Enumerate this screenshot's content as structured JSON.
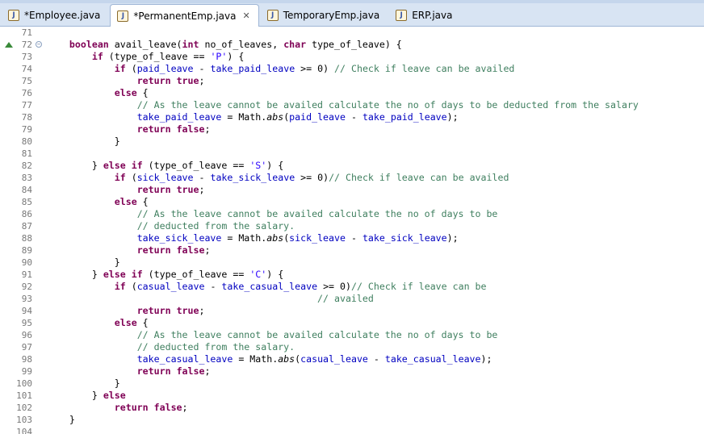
{
  "tabs": [
    {
      "label": "*Employee.java",
      "active": false,
      "closable": false
    },
    {
      "label": "*PermanentEmp.java",
      "active": true,
      "closable": true
    },
    {
      "label": "TemporaryEmp.java",
      "active": false,
      "closable": false
    },
    {
      "label": "ERP.java",
      "active": false,
      "closable": false
    }
  ],
  "colors": {
    "keyword": "#7f0055",
    "field": "#0000c0",
    "string": "#2a00ff",
    "comment": "#3f7f5f",
    "line_number": "#787878"
  },
  "lines": [
    {
      "num": "71",
      "tokens": []
    },
    {
      "num": "72",
      "mark": true,
      "fold": true,
      "tokens": [
        {
          "t": "    "
        },
        {
          "t": "boolean",
          "c": "kw"
        },
        {
          "t": " avail_leave("
        },
        {
          "t": "int",
          "c": "kw"
        },
        {
          "t": " no_of_leaves, "
        },
        {
          "t": "char",
          "c": "kw"
        },
        {
          "t": " type_of_leave) {"
        }
      ]
    },
    {
      "num": "73",
      "tokens": [
        {
          "t": "        "
        },
        {
          "t": "if",
          "c": "kw"
        },
        {
          "t": " (type_of_leave == "
        },
        {
          "t": "'P'",
          "c": "str"
        },
        {
          "t": ") {"
        }
      ]
    },
    {
      "num": "74",
      "tokens": [
        {
          "t": "            "
        },
        {
          "t": "if",
          "c": "kw"
        },
        {
          "t": " ("
        },
        {
          "t": "paid_leave",
          "c": "fld"
        },
        {
          "t": " - "
        },
        {
          "t": "take_paid_leave",
          "c": "fld"
        },
        {
          "t": " >= 0) "
        },
        {
          "t": "// Check if leave can be availed",
          "c": "cmt"
        }
      ]
    },
    {
      "num": "75",
      "tokens": [
        {
          "t": "                "
        },
        {
          "t": "return",
          "c": "kw"
        },
        {
          "t": " "
        },
        {
          "t": "true",
          "c": "kw"
        },
        {
          "t": ";"
        }
      ]
    },
    {
      "num": "76",
      "tokens": [
        {
          "t": "            "
        },
        {
          "t": "else",
          "c": "kw"
        },
        {
          "t": " {"
        }
      ]
    },
    {
      "num": "77",
      "tokens": [
        {
          "t": "                "
        },
        {
          "t": "// As the leave cannot be availed calculate the no of days to be deducted from the salary",
          "c": "cmt"
        }
      ]
    },
    {
      "num": "78",
      "tokens": [
        {
          "t": "                "
        },
        {
          "t": "take_paid_leave",
          "c": "fld"
        },
        {
          "t": " = Math."
        },
        {
          "t": "abs",
          "c": "it"
        },
        {
          "t": "("
        },
        {
          "t": "paid_leave",
          "c": "fld"
        },
        {
          "t": " - "
        },
        {
          "t": "take_paid_leave",
          "c": "fld"
        },
        {
          "t": ");"
        }
      ]
    },
    {
      "num": "79",
      "tokens": [
        {
          "t": "                "
        },
        {
          "t": "return",
          "c": "kw"
        },
        {
          "t": " "
        },
        {
          "t": "false",
          "c": "kw"
        },
        {
          "t": ";"
        }
      ]
    },
    {
      "num": "80",
      "tokens": [
        {
          "t": "            }"
        }
      ]
    },
    {
      "num": "81",
      "tokens": []
    },
    {
      "num": "82",
      "tokens": [
        {
          "t": "        } "
        },
        {
          "t": "else",
          "c": "kw"
        },
        {
          "t": " "
        },
        {
          "t": "if",
          "c": "kw"
        },
        {
          "t": " (type_of_leave == "
        },
        {
          "t": "'S'",
          "c": "str"
        },
        {
          "t": ") {"
        }
      ]
    },
    {
      "num": "83",
      "tokens": [
        {
          "t": "            "
        },
        {
          "t": "if",
          "c": "kw"
        },
        {
          "t": " ("
        },
        {
          "t": "sick_leave",
          "c": "fld"
        },
        {
          "t": " - "
        },
        {
          "t": "take_sick_leave",
          "c": "fld"
        },
        {
          "t": " >= 0)"
        },
        {
          "t": "// Check if leave can be availed",
          "c": "cmt"
        }
      ]
    },
    {
      "num": "84",
      "tokens": [
        {
          "t": "                "
        },
        {
          "t": "return",
          "c": "kw"
        },
        {
          "t": " "
        },
        {
          "t": "true",
          "c": "kw"
        },
        {
          "t": ";"
        }
      ]
    },
    {
      "num": "85",
      "tokens": [
        {
          "t": "            "
        },
        {
          "t": "else",
          "c": "kw"
        },
        {
          "t": " {"
        }
      ]
    },
    {
      "num": "86",
      "tokens": [
        {
          "t": "                "
        },
        {
          "t": "// As the leave cannot be availed calculate the no of days to be",
          "c": "cmt"
        }
      ]
    },
    {
      "num": "87",
      "tokens": [
        {
          "t": "                "
        },
        {
          "t": "// deducted from the salary.",
          "c": "cmt"
        }
      ]
    },
    {
      "num": "88",
      "tokens": [
        {
          "t": "                "
        },
        {
          "t": "take_sick_leave",
          "c": "fld"
        },
        {
          "t": " = Math."
        },
        {
          "t": "abs",
          "c": "it"
        },
        {
          "t": "("
        },
        {
          "t": "sick_leave",
          "c": "fld"
        },
        {
          "t": " - "
        },
        {
          "t": "take_sick_leave",
          "c": "fld"
        },
        {
          "t": ");"
        }
      ]
    },
    {
      "num": "89",
      "tokens": [
        {
          "t": "                "
        },
        {
          "t": "return",
          "c": "kw"
        },
        {
          "t": " "
        },
        {
          "t": "false",
          "c": "kw"
        },
        {
          "t": ";"
        }
      ]
    },
    {
      "num": "90",
      "tokens": [
        {
          "t": "            }"
        }
      ]
    },
    {
      "num": "91",
      "tokens": [
        {
          "t": "        } "
        },
        {
          "t": "else",
          "c": "kw"
        },
        {
          "t": " "
        },
        {
          "t": "if",
          "c": "kw"
        },
        {
          "t": " (type_of_leave == "
        },
        {
          "t": "'C'",
          "c": "str"
        },
        {
          "t": ") {"
        }
      ]
    },
    {
      "num": "92",
      "tokens": [
        {
          "t": "            "
        },
        {
          "t": "if",
          "c": "kw"
        },
        {
          "t": " ("
        },
        {
          "t": "casual_leave",
          "c": "fld"
        },
        {
          "t": " - "
        },
        {
          "t": "take_casual_leave",
          "c": "fld"
        },
        {
          "t": " >= 0)"
        },
        {
          "t": "// Check if leave can be",
          "c": "cmt"
        }
      ]
    },
    {
      "num": "93",
      "tokens": [
        {
          "t": "                                                "
        },
        {
          "t": "// availed",
          "c": "cmt"
        }
      ]
    },
    {
      "num": "94",
      "tokens": [
        {
          "t": "                "
        },
        {
          "t": "return",
          "c": "kw"
        },
        {
          "t": " "
        },
        {
          "t": "true",
          "c": "kw"
        },
        {
          "t": ";"
        }
      ]
    },
    {
      "num": "95",
      "tokens": [
        {
          "t": "            "
        },
        {
          "t": "else",
          "c": "kw"
        },
        {
          "t": " {"
        }
      ]
    },
    {
      "num": "96",
      "tokens": [
        {
          "t": "                "
        },
        {
          "t": "// As the leave cannot be availed calculate the no of days to be",
          "c": "cmt"
        }
      ]
    },
    {
      "num": "97",
      "tokens": [
        {
          "t": "                "
        },
        {
          "t": "// deducted from the salary.",
          "c": "cmt"
        }
      ]
    },
    {
      "num": "98",
      "tokens": [
        {
          "t": "                "
        },
        {
          "t": "take_casual_leave",
          "c": "fld"
        },
        {
          "t": " = Math."
        },
        {
          "t": "abs",
          "c": "it"
        },
        {
          "t": "("
        },
        {
          "t": "casual_leave",
          "c": "fld"
        },
        {
          "t": " - "
        },
        {
          "t": "take_casual_leave",
          "c": "fld"
        },
        {
          "t": ");"
        }
      ]
    },
    {
      "num": "99",
      "tokens": [
        {
          "t": "                "
        },
        {
          "t": "return",
          "c": "kw"
        },
        {
          "t": " "
        },
        {
          "t": "false",
          "c": "kw"
        },
        {
          "t": ";"
        }
      ]
    },
    {
      "num": "100",
      "tokens": [
        {
          "t": "            }"
        }
      ]
    },
    {
      "num": "101",
      "tokens": [
        {
          "t": "        } "
        },
        {
          "t": "else",
          "c": "kw"
        }
      ]
    },
    {
      "num": "102",
      "tokens": [
        {
          "t": "            "
        },
        {
          "t": "return",
          "c": "kw"
        },
        {
          "t": " "
        },
        {
          "t": "false",
          "c": "kw"
        },
        {
          "t": ";"
        }
      ]
    },
    {
      "num": "103",
      "tokens": [
        {
          "t": "    }"
        }
      ]
    },
    {
      "num": "104",
      "tokens": []
    }
  ]
}
